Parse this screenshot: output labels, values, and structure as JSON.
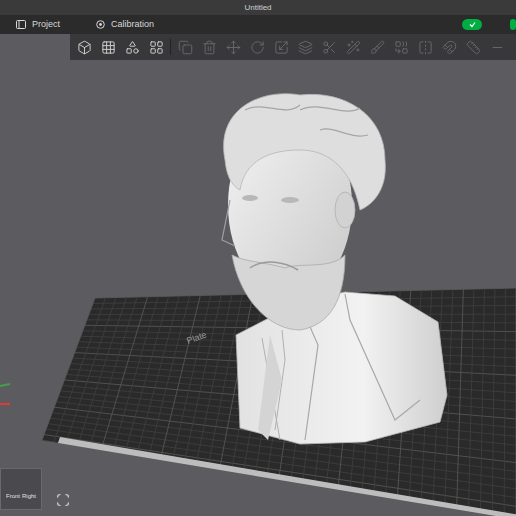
{
  "window": {
    "title": "Untitled"
  },
  "tabs": [
    {
      "label": "Project",
      "selected": false
    },
    {
      "label": "Calibration",
      "selected": false
    }
  ],
  "toolbar": {
    "tools": [
      {
        "disabled": false
      },
      {
        "disabled": false
      },
      {
        "disabled": false
      },
      {
        "disabled": false
      },
      {
        "disabled": true
      },
      {
        "disabled": true
      },
      {
        "disabled": true
      },
      {
        "disabled": true
      },
      {
        "disabled": true
      },
      {
        "disabled": true
      },
      {
        "disabled": true
      },
      {
        "disabled": true
      },
      {
        "disabled": true
      },
      {
        "disabled": true
      },
      {
        "disabled": true
      },
      {
        "disabled": true
      },
      {
        "disabled": true
      },
      {
        "disabled": true
      }
    ]
  },
  "plate": {
    "label": "Plate"
  },
  "view_cube": {
    "faces": [
      "Front",
      "Right"
    ]
  }
}
